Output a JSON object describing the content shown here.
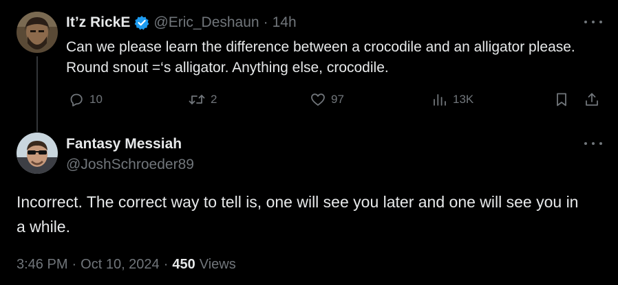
{
  "parent_tweet": {
    "author_name": "It’z RickE",
    "handle": "@Eric_Deshaun",
    "separator": "·",
    "time_ago": "14h",
    "text": "Can we please learn the difference between a crocodile and an alligator please. Round snout =‘s alligator. Anything else, crocodile.",
    "verified_icon": "verified-badge-icon",
    "more_icon": "more-options-icon",
    "actions": {
      "reply_count": "10",
      "repost_count": "2",
      "like_count": "97",
      "view_count": "13K"
    }
  },
  "reply_tweet": {
    "author_name": "Fantasy Messiah",
    "handle": "@JoshSchroeder89",
    "text": "Incorrect. The correct way to tell is, one will see you later and one will see you in a while.",
    "time": "3:46 PM",
    "date": "Oct 10, 2024",
    "separator": "·",
    "views_count": "450",
    "views_label": "Views",
    "more_icon": "more-options-icon"
  },
  "colors": {
    "background": "#000000",
    "primary_text": "#e7e9ea",
    "secondary_text": "#71767b",
    "verified_blue": "#1d9bf0",
    "thread_line": "#333639"
  }
}
